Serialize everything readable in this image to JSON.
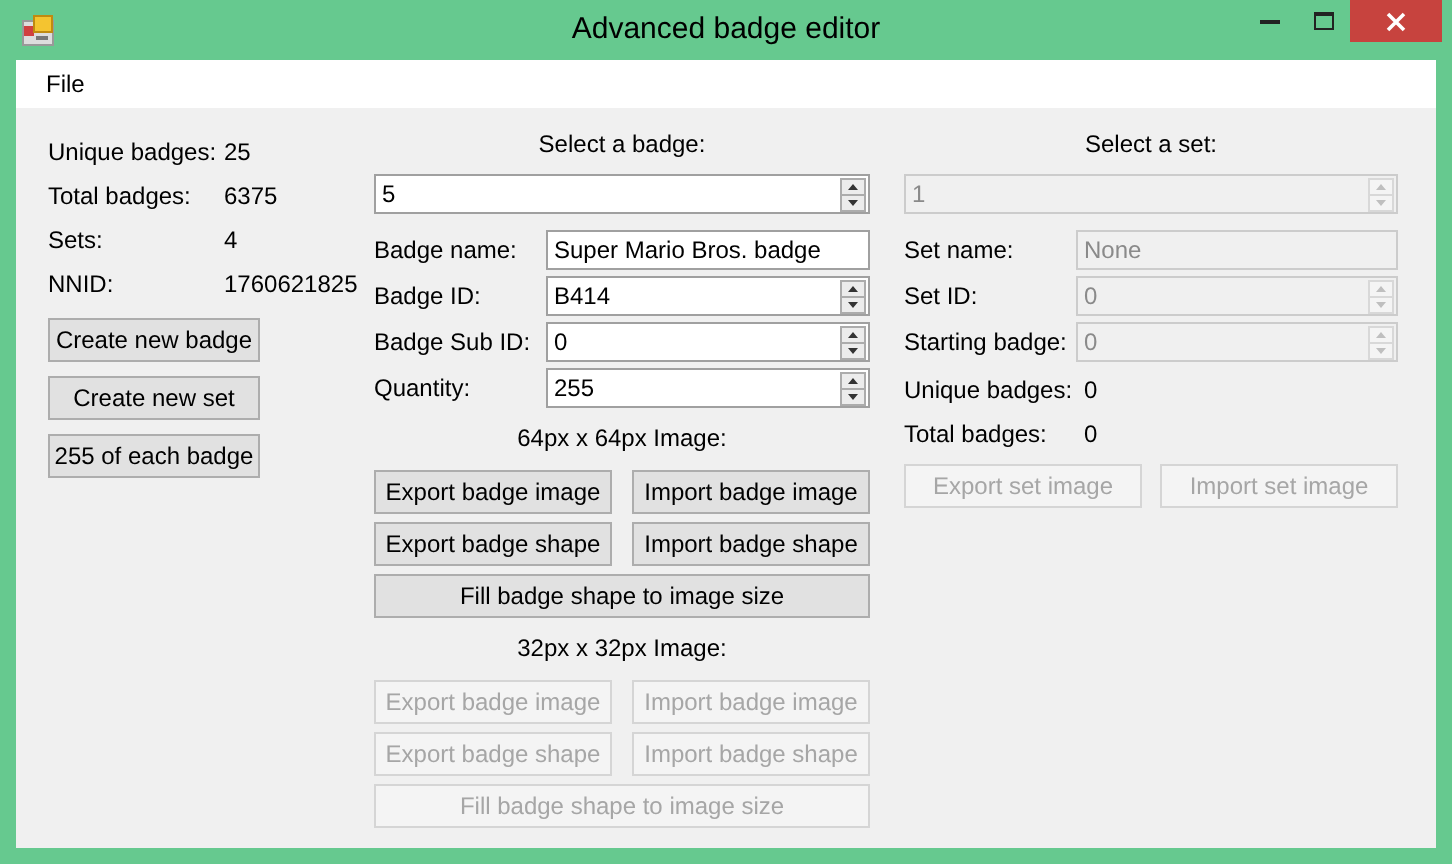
{
  "window": {
    "title": "Advanced badge editor"
  },
  "menu": [
    {
      "label": "File"
    }
  ],
  "stats": [
    {
      "label": "Unique badges:",
      "value": "25"
    },
    {
      "label": "Total badges:",
      "value": "6375"
    },
    {
      "label": "Sets:",
      "value": "4"
    },
    {
      "label": "NNID:",
      "value": "1760621825"
    }
  ],
  "actions": [
    {
      "label": "Create new badge",
      "disabled": false
    },
    {
      "label": "Create new set",
      "disabled": false
    },
    {
      "label": "255 of each badge",
      "disabled": false
    }
  ],
  "badge_panel": {
    "title": "Select a badge:",
    "selector": {
      "value": "5",
      "kind": "spinner",
      "disabled": false
    },
    "fields": [
      {
        "label": "Badge name:",
        "value": "Super Mario Bros. badge",
        "kind": "text",
        "disabled": false
      },
      {
        "label": "Badge ID:",
        "value": "B414",
        "kind": "spinner",
        "disabled": false
      },
      {
        "label": "Badge Sub ID:",
        "value": "0",
        "kind": "spinner",
        "disabled": false
      },
      {
        "label": "Quantity:",
        "value": "255",
        "kind": "spinner",
        "disabled": false
      }
    ],
    "sections": [
      {
        "heading": "64px x 64px Image:",
        "rows": [
          [
            {
              "label": "Export badge image",
              "disabled": false
            },
            {
              "label": "Import badge image",
              "disabled": false
            }
          ],
          [
            {
              "label": "Export badge shape",
              "disabled": false
            },
            {
              "label": "Import badge shape",
              "disabled": false
            }
          ],
          [
            {
              "label": "Fill badge shape to image size",
              "disabled": false
            }
          ]
        ]
      },
      {
        "heading": "32px x 32px Image:",
        "rows": [
          [
            {
              "label": "Export badge image",
              "disabled": true
            },
            {
              "label": "Import badge image",
              "disabled": true
            }
          ],
          [
            {
              "label": "Export badge shape",
              "disabled": true
            },
            {
              "label": "Import badge shape",
              "disabled": true
            }
          ],
          [
            {
              "label": "Fill badge shape to image size",
              "disabled": true
            }
          ]
        ]
      }
    ]
  },
  "set_panel": {
    "title": "Select a set:",
    "selector": {
      "value": "1",
      "kind": "spinner",
      "disabled": true
    },
    "fields": [
      {
        "label": "Set name:",
        "value": "None",
        "kind": "text",
        "disabled": true
      },
      {
        "label": "Set ID:",
        "value": "0",
        "kind": "spinner",
        "disabled": true
      },
      {
        "label": "Starting badge:",
        "value": "0",
        "kind": "spinner",
        "disabled": true
      }
    ],
    "stats": [
      {
        "label": "Unique badges:",
        "value": "0"
      },
      {
        "label": "Total badges:",
        "value": "0"
      }
    ],
    "buttons": [
      {
        "label": "Export set image",
        "disabled": true
      },
      {
        "label": "Import set image",
        "disabled": true
      }
    ]
  }
}
